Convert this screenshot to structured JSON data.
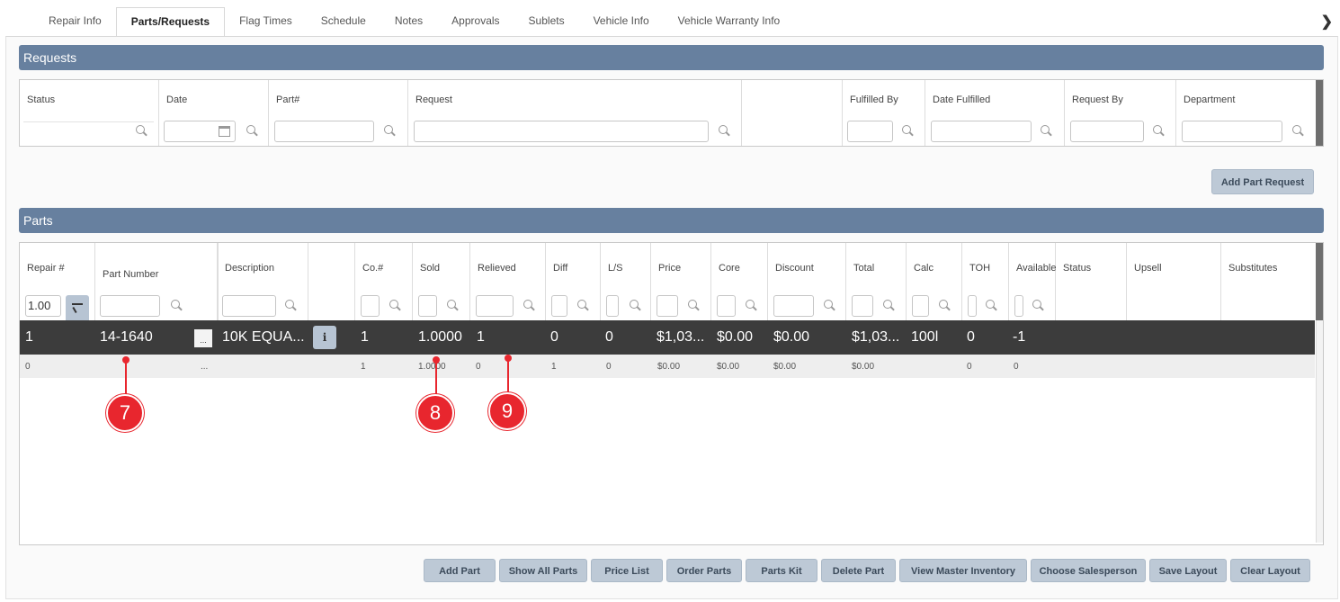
{
  "tabs": [
    "Repair Info",
    "Parts/Requests",
    "Flag Times",
    "Schedule",
    "Notes",
    "Approvals",
    "Sublets",
    "Vehicle Info",
    "Vehicle Warranty Info"
  ],
  "requests": {
    "title": "Requests",
    "columns": [
      "Status",
      "Date",
      "Part#",
      "Request",
      "",
      "Fulfilled By",
      "Date Fulfilled",
      "Request By",
      "Department"
    ],
    "add_button": "Add Part Request"
  },
  "parts": {
    "title": "Parts",
    "columns": [
      "Repair #",
      "Part Number",
      "",
      "Description",
      "",
      "Co.#",
      "Sold",
      "Relieved",
      "Diff",
      "L/S",
      "Price",
      "Core",
      "Discount",
      "Total",
      "Calc",
      "TOH",
      "Available",
      "Status",
      "Upsell",
      "Substitutes"
    ],
    "repair_filter_value": "1.00",
    "row_main": {
      "repair": "1",
      "part_number": "14-1640",
      "ellipsis": "...",
      "description": "10K EQUA...",
      "info_icon": "i",
      "co": "1",
      "sold": "1.0000",
      "relieved": "1",
      "diff": "0",
      "ls": "0",
      "price": "$1,03...",
      "core": "$0.00",
      "discount": "$0.00",
      "total": "$1,03...",
      "calc": "100l",
      "toh": "0",
      "available": "-1"
    },
    "row_sub": {
      "repair": "0",
      "ellipsis": "...",
      "co": "1",
      "sold": "1.0000",
      "relieved": "0",
      "diff": "1",
      "ls": "0",
      "price": "$0.00",
      "core": "$0.00",
      "discount": "$0.00",
      "total": "$0.00",
      "toh": "0",
      "available": "0"
    }
  },
  "buttons": [
    "Add Part",
    "Show All Parts",
    "Price List",
    "Order Parts",
    "Parts Kit",
    "Delete Part",
    "View Master Inventory",
    "Choose Salesperson",
    "Save Layout",
    "Clear Layout"
  ],
  "markers": [
    "7",
    "8",
    "9"
  ]
}
